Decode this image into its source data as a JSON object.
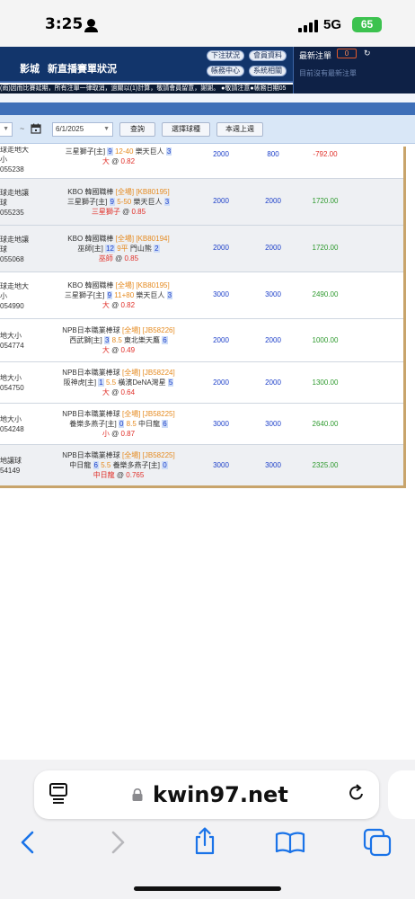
{
  "status": {
    "time": "3:25",
    "network": "5G",
    "battery": "65"
  },
  "header": {
    "nav": [
      "影城",
      "新直播",
      "賽單狀況"
    ],
    "buttons": [
      "下注狀況",
      "會員資料",
      "帳務中心",
      "系統相關"
    ],
    "latest_bets_title": "最新注單",
    "latest_bets_count": "0",
    "refresh_icon": "↻",
    "latest_bets_empty": "目前沒有最新注單",
    "marquee": "(雨)因而比賽延期，所有注單一律取消，過關以(1)計算，敬請會員留意，謝謝。 ●敬請注意●帳務日期05"
  },
  "filter": {
    "date_value": "6/1/2025",
    "query_label": "查詢",
    "sport_select_label": "選擇球種",
    "this_week_label": "本週上週"
  },
  "bets": [
    {
      "type": [
        "球走地大",
        "小",
        "055238"
      ],
      "league": "",
      "tag": "",
      "code": "",
      "home": "三星獅子[主]",
      "home_pitcher": "9",
      "line": "12-40",
      "away": "樂天巨人",
      "away_pitcher": "3",
      "pick": "大",
      "odds": "0.82",
      "stake": "2000",
      "valid": "800",
      "result": "-792.00"
    },
    {
      "type": [
        "球走地讓",
        "球",
        "055235"
      ],
      "league": "KBO 韓國職棒",
      "tag": "[全場]",
      "code": "[KB80195]",
      "home": "三星獅子[主]",
      "home_pitcher": "9",
      "line": "5-50",
      "away": "樂天巨人",
      "away_pitcher": "3",
      "pick": "三星獅子",
      "odds": "0.85",
      "stake": "2000",
      "valid": "2000",
      "result": "1720.00"
    },
    {
      "type": [
        "球走地讓",
        "球",
        "055068"
      ],
      "league": "KBO 韓國職棒",
      "tag": "[全場]",
      "code": "[KB80194]",
      "home": "巫師[主]",
      "home_pitcher": "12",
      "line": "9平",
      "away": "門山熊",
      "away_pitcher": "2",
      "pick": "巫師",
      "odds": "0.85",
      "stake": "2000",
      "valid": "2000",
      "result": "1720.00"
    },
    {
      "type": [
        "球走地大",
        "小",
        "054990"
      ],
      "league": "KBO 韓國職棒",
      "tag": "[全場]",
      "code": "[KB80195]",
      "home": "三星獅子[主]",
      "home_pitcher": "9",
      "line": "11+80",
      "away": "樂天巨人",
      "away_pitcher": "3",
      "pick": "大",
      "odds": "0.82",
      "stake": "3000",
      "valid": "3000",
      "result": "2490.00"
    },
    {
      "type": [
        "地大小",
        "054774"
      ],
      "league": "NPB日本職業棒球",
      "tag": "[全場]",
      "code": "[JB58226]",
      "home": "西武獅[主]",
      "home_pitcher": "3",
      "line": "8.5",
      "away": "東北樂天鷹",
      "away_pitcher": "6",
      "pick": "大",
      "odds": "0.49",
      "stake": "2000",
      "valid": "2000",
      "result": "1000.00"
    },
    {
      "type": [
        "地大小",
        "054750"
      ],
      "league": "NPB日本職業棒球",
      "tag": "[全場]",
      "code": "[JB58224]",
      "home": "阪神虎[主]",
      "home_pitcher": "1",
      "line": "5.5",
      "away": "橫濱DeNA灣星",
      "away_pitcher": "5",
      "pick": "大",
      "odds": "0.64",
      "stake": "2000",
      "valid": "2000",
      "result": "1300.00"
    },
    {
      "type": [
        "地大小",
        "054248"
      ],
      "league": "NPB日本職業棒球",
      "tag": "[全場]",
      "code": "[JB58225]",
      "home": "養樂多燕子[主]",
      "home_pitcher": "0",
      "line": "8.5",
      "away": "中日龍",
      "away_pitcher": "6",
      "pick": "小",
      "odds": "0.87",
      "stake": "3000",
      "valid": "3000",
      "result": "2640.00"
    },
    {
      "type": [
        "地讓球",
        "54149"
      ],
      "league": "NPB日本職業棒球",
      "tag": "[全場]",
      "code": "[JB58225]",
      "home": "中日龍",
      "home_pitcher": "6",
      "line": "5.5",
      "away": "養樂多燕子[主]",
      "away_pitcher": "0",
      "pick": "中日龍",
      "odds": "0.765",
      "stake": "3000",
      "valid": "3000",
      "result": "2325.00"
    }
  ],
  "browser": {
    "url": "kwin97.net"
  },
  "colors": {
    "header_bg": "#12356b",
    "positive": "#2e9a2e",
    "negative": "#e0312a",
    "number_blue": "#1c3fc9"
  }
}
